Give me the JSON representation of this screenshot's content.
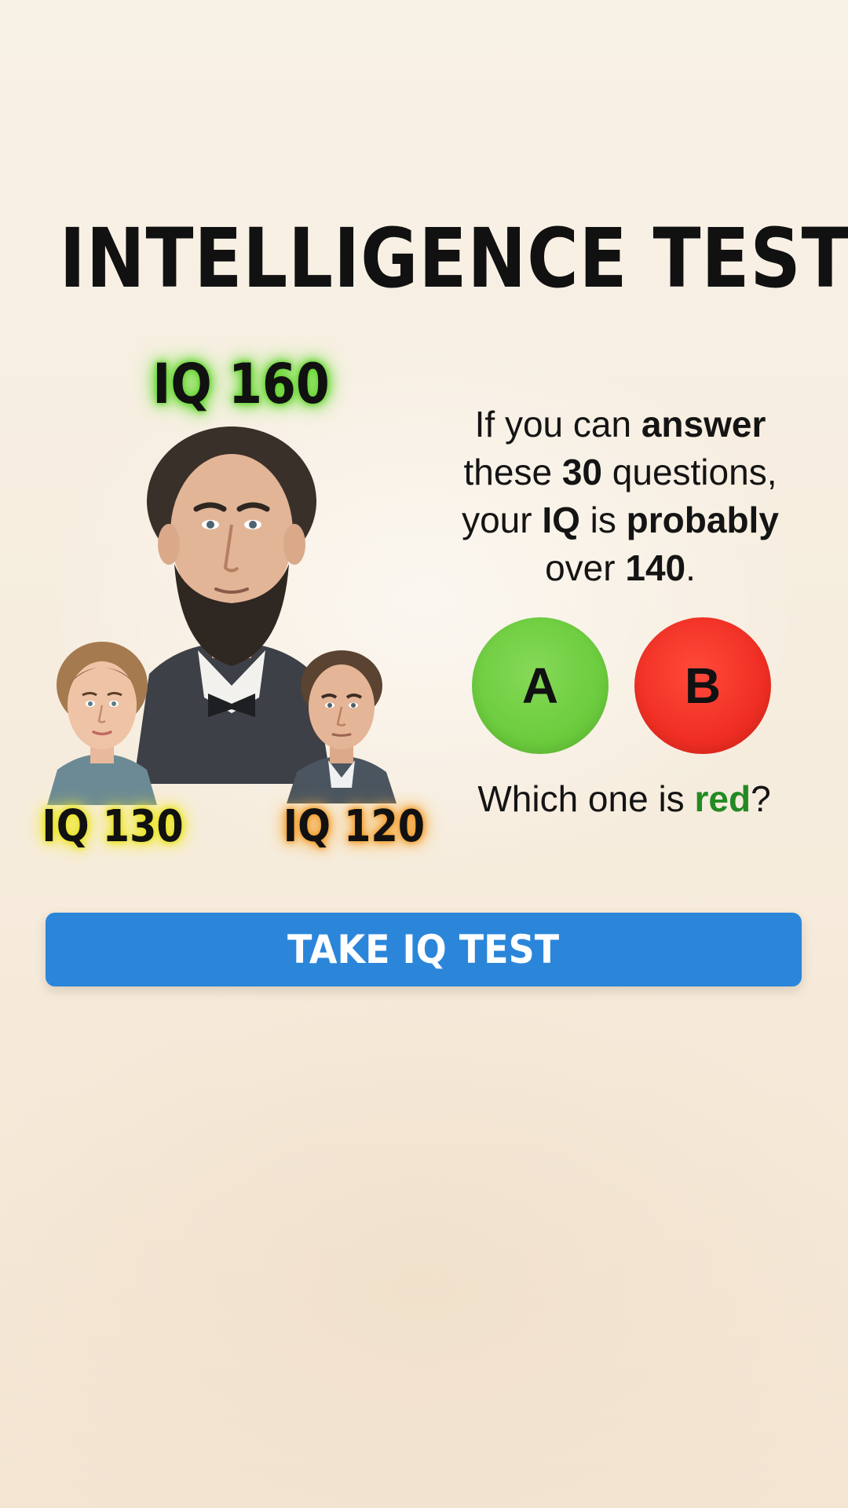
{
  "title": "INTELLIGENCE TEST",
  "portraits": {
    "main": {
      "iq_label": "IQ 160",
      "glow_color": "#5fd12a"
    },
    "woman": {
      "iq_label": "IQ 130",
      "glow_color": "#e7e21f"
    },
    "man": {
      "iq_label": "IQ 120",
      "glow_color": "#f09a2a"
    }
  },
  "question": {
    "line1_pre": "If you can ",
    "line1_bold": "answer",
    "line2_pre": "these ",
    "line2_bold": "30",
    "line2_post": " questions,",
    "line3_pre": "your ",
    "line3_bold1": "IQ",
    "line3_mid": " is ",
    "line3_bold2": "probably",
    "line4_pre": "over ",
    "line4_bold": "140",
    "line4_post": "."
  },
  "choices": [
    {
      "label": "A",
      "color": "#6ccc3e"
    },
    {
      "label": "B",
      "color": "#f02f24"
    }
  ],
  "prompt": {
    "pre": "Which one is ",
    "highlight": "red",
    "post": "?",
    "highlight_color": "#238a23"
  },
  "cta": {
    "label": "TAKE IQ TEST",
    "color": "#2b86da"
  }
}
